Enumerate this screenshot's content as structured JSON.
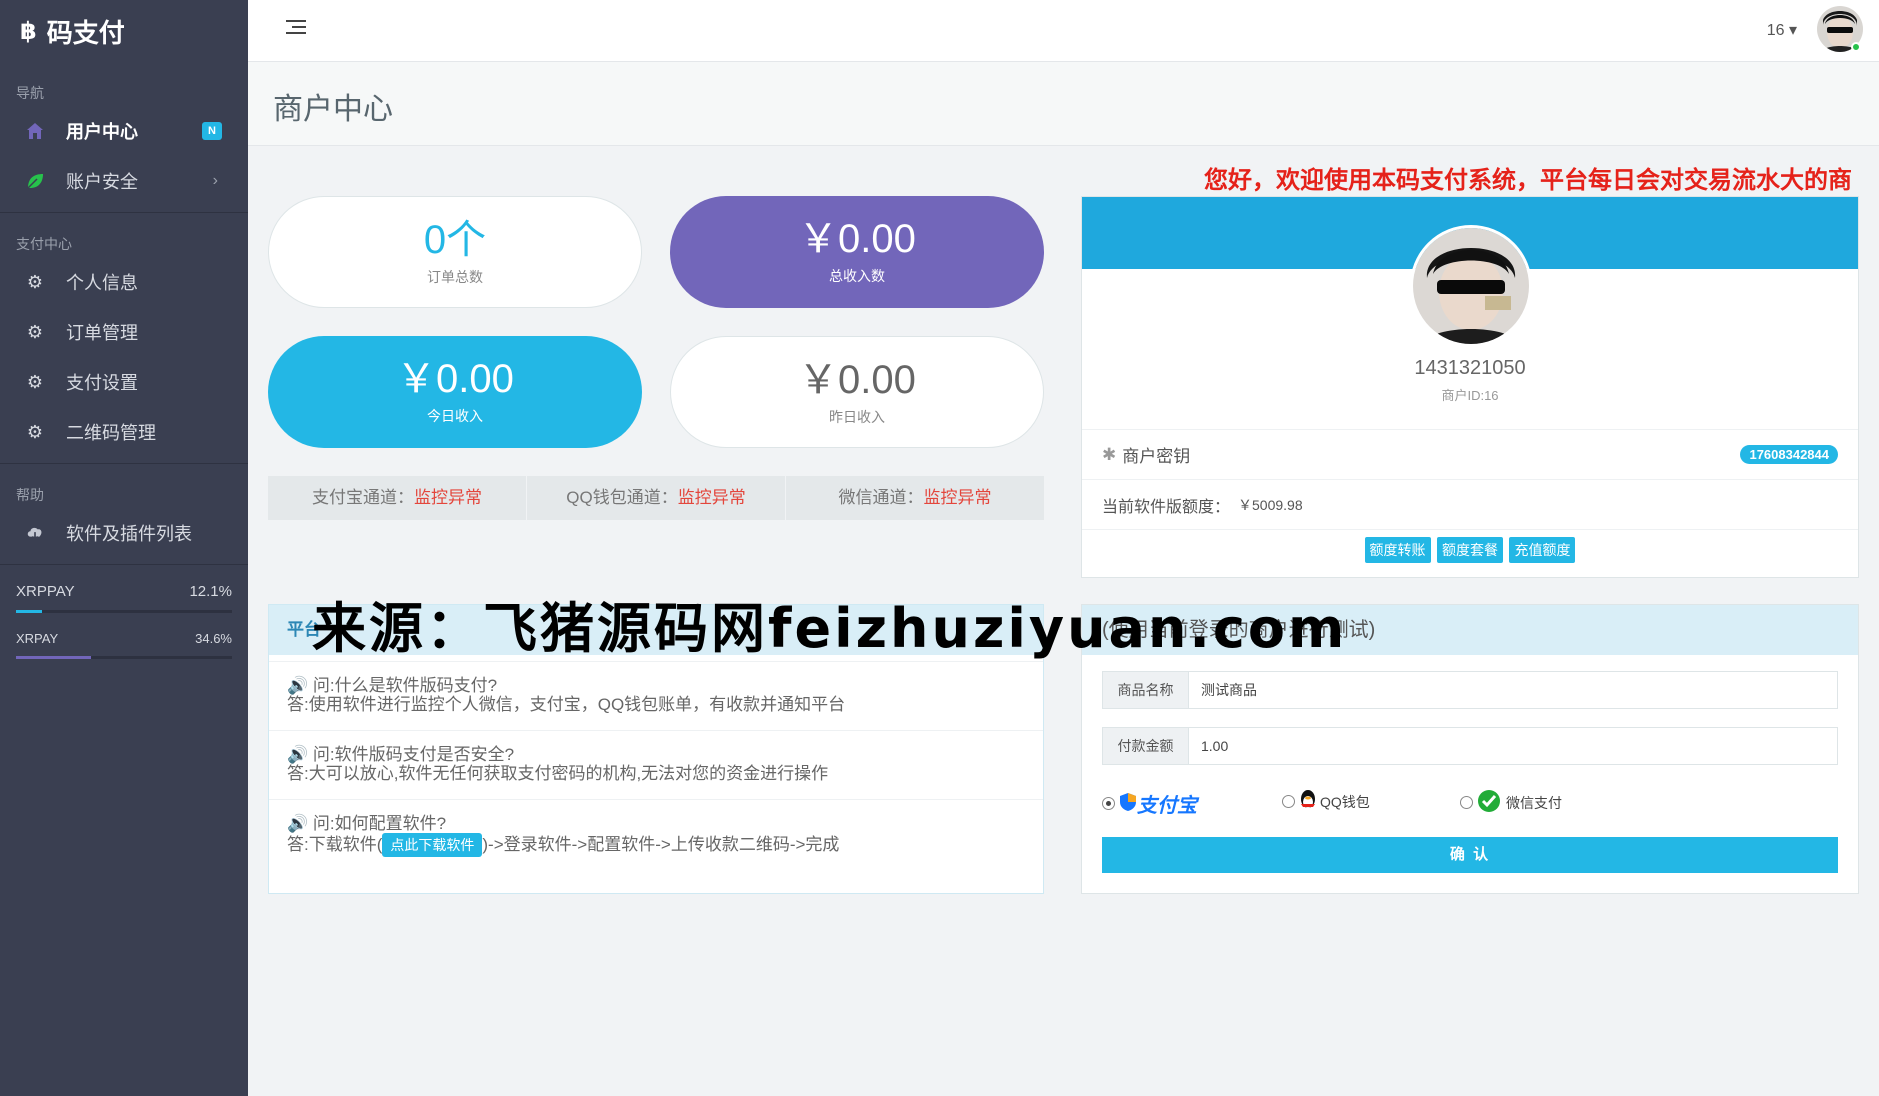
{
  "brand": {
    "logo": "฿",
    "name": "码支付"
  },
  "sidebar": {
    "sections": [
      "导航",
      "支付中心",
      "帮助"
    ],
    "nav": [
      {
        "label": "用户中心",
        "badge": "N"
      },
      {
        "label": "账户安全"
      }
    ],
    "pay": [
      {
        "label": "个人信息"
      },
      {
        "label": "订单管理"
      },
      {
        "label": "支付设置"
      },
      {
        "label": "二维码管理"
      }
    ],
    "help": [
      {
        "label": "软件及插件列表"
      }
    ],
    "progress": [
      {
        "name": "XRPPAY",
        "pct": "12.1%",
        "value": 0.121,
        "color": "#23b7e5"
      },
      {
        "name": "XRPAY",
        "pct": "34.6%",
        "value": 0.346,
        "color": "#7266ba"
      }
    ]
  },
  "header": {
    "user_num": "16 ▾"
  },
  "page": {
    "title": "商户中心"
  },
  "stats": [
    {
      "value": "0个",
      "label": "订单总数"
    },
    {
      "value": "￥0.00",
      "label": "总收入数"
    },
    {
      "value": "￥0.00",
      "label": "今日收入"
    },
    {
      "value": "￥0.00",
      "label": "昨日收入"
    }
  ],
  "channels": [
    {
      "name": "支付宝通道：",
      "status": "监控异常"
    },
    {
      "name": "QQ钱包通道：",
      "status": "监控异常"
    },
    {
      "name": "微信通道：",
      "status": "监控异常"
    }
  ],
  "notice": "您好，欢迎使用本码支付系统，平台每日会对交易流水大的商",
  "profile": {
    "name": "1431321050",
    "id": "商户ID:16",
    "key_label": "商户密钥",
    "key_badge": "17608342844",
    "quota_label": "当前软件版额度：",
    "quota_value": "￥5009.98",
    "buttons": [
      "额度转账",
      "额度套餐",
      "充值额度"
    ]
  },
  "faq": {
    "head": "平台",
    "items": [
      {
        "q": "问:什么是软件版码支付?",
        "a": "答:使用软件进行监控个人微信，支付宝，QQ钱包账单，有收款并通知平台"
      },
      {
        "q": "问:软件版码支付是否安全?",
        "a": "答:大可以放心,软件无任何获取支付密码的机构,无法对您的资金进行操作"
      },
      {
        "q": "问:如何配置软件?",
        "a_pre": "答:下载软件(",
        "a_btn": "点此下载软件",
        "a_post": ")->登录软件->配置软件->上传收款二维码->完成"
      }
    ]
  },
  "test": {
    "head": "(使用当前登录的商户进行测试)",
    "product_label": "商品名称",
    "product_value": "测试商品",
    "amount_label": "付款金额",
    "amount_value": "1.00",
    "options": [
      "支付宝",
      "QQ钱包",
      "微信支付"
    ],
    "confirm": "确 认"
  },
  "watermark": "来源：飞猪源码网feizhuziyuan.com"
}
